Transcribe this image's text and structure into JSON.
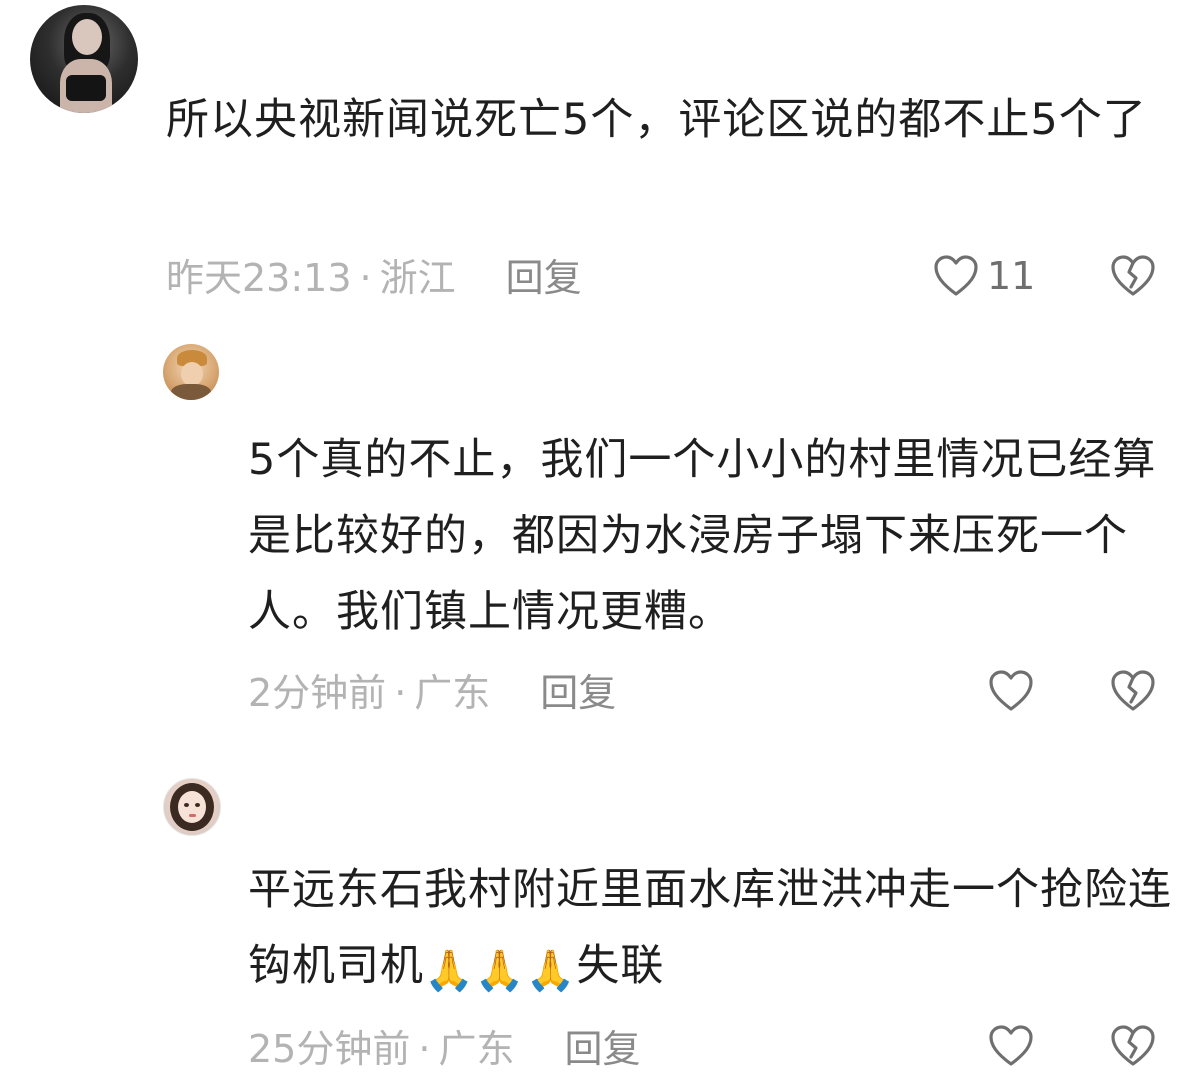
{
  "comments": [
    {
      "text": "所以央视新闻说死亡5个，评论区说的都不止5个了",
      "time": "昨天23:13",
      "location": "浙江",
      "reply_label": "回复",
      "likes": "11"
    },
    {
      "text": "5个真的不止，我们一个小小的村里情况已经算是比较好的，都因为水浸房子塌下来压死一个人。我们镇上情况更糟。",
      "time": "2分钟前",
      "location": "广东",
      "reply_label": "回复",
      "likes": ""
    },
    {
      "text_part1": "平远东石我村附近里面水库泄洪冲走一个抢险连钩机司机",
      "emojis": "🙏🙏🙏",
      "text_part2": "失联",
      "time": "25分钟前",
      "location": "广东",
      "reply_label": "回复",
      "likes": ""
    }
  ],
  "separator": "·",
  "icons": {
    "like": "heart-outline-icon",
    "dislike": "broken-heart-icon"
  },
  "colors": {
    "text": "#1f1f1f",
    "meta": "#b3b3b3",
    "reply": "#8a8a8a",
    "icon": "#6f6f6f"
  }
}
